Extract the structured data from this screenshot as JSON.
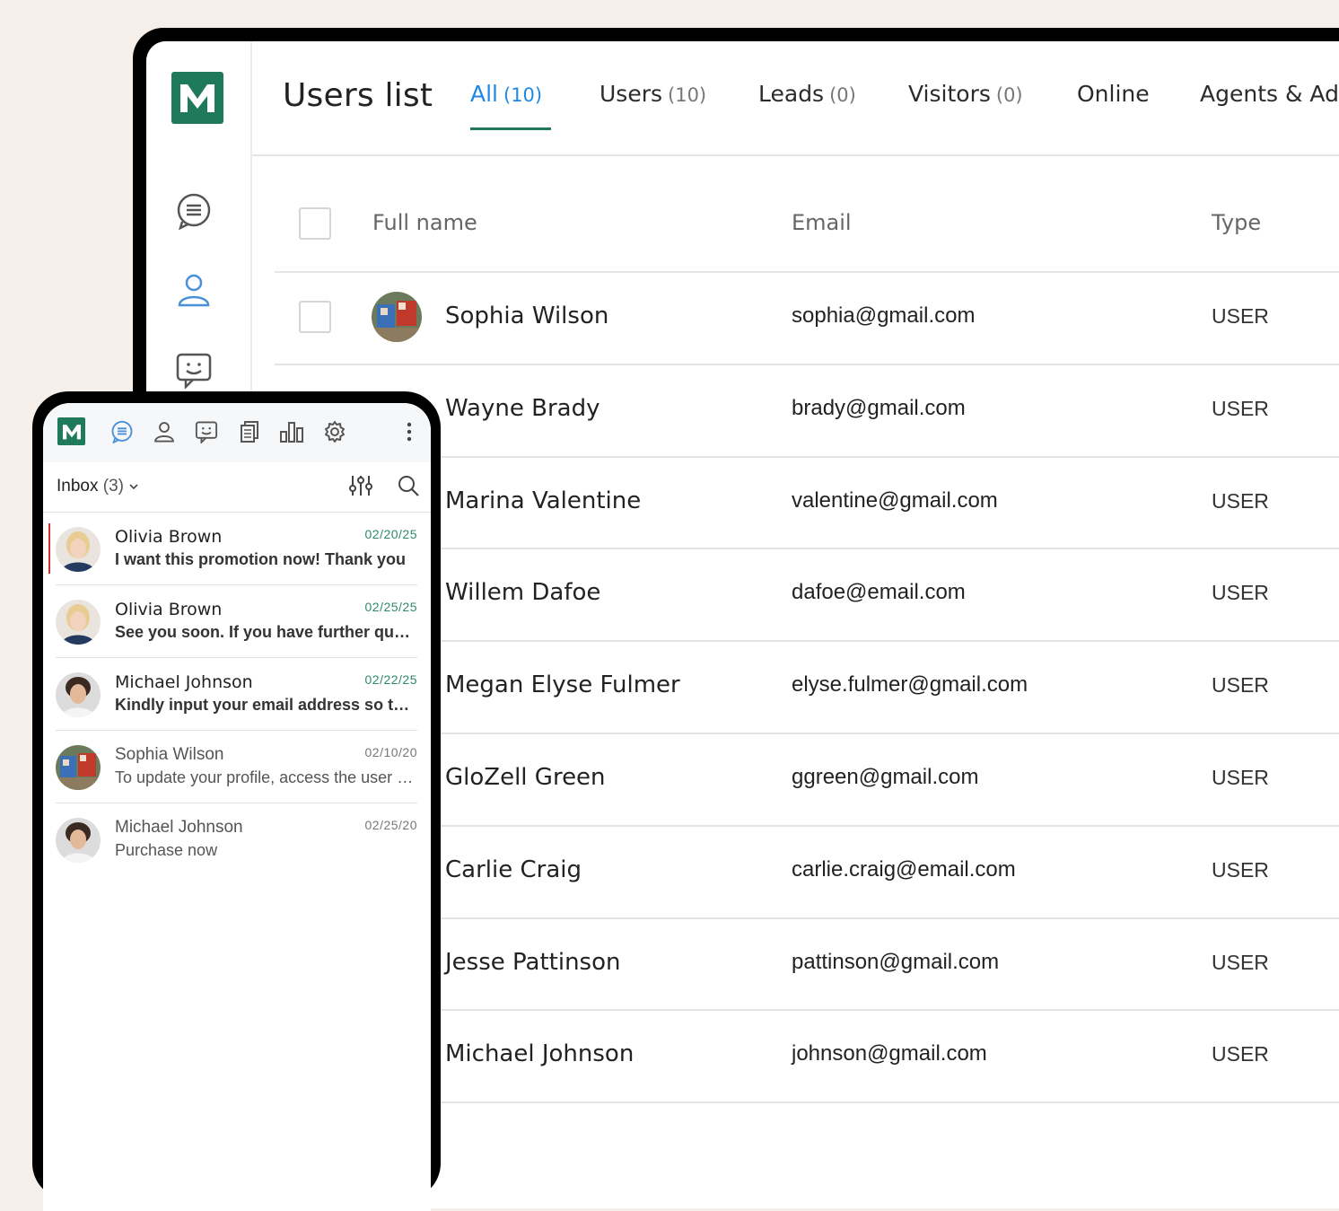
{
  "app": {
    "logo_letter": "M",
    "brand_color": "#1f7a5c",
    "accent_color": "#1e88e5"
  },
  "sidebar": {
    "icons": [
      "chat-icon",
      "user-icon",
      "feedback-icon"
    ]
  },
  "header": {
    "title": "Users list",
    "tabs": [
      {
        "label": "All",
        "count": "(10)",
        "active": true
      },
      {
        "label": "Users",
        "count": "(10)"
      },
      {
        "label": "Leads",
        "count": "(0)"
      },
      {
        "label": "Visitors",
        "count": "(0)"
      },
      {
        "label": "Online",
        "count": ""
      },
      {
        "label": "Agents & Ad",
        "count": ""
      }
    ]
  },
  "table": {
    "columns": [
      "Full name",
      "Email",
      "Type"
    ],
    "rows": [
      {
        "name": "Sophia Wilson",
        "email": "sophia@gmail.com",
        "type": "USER"
      },
      {
        "name": "Wayne Brady",
        "email": "brady@gmail.com",
        "type": "USER"
      },
      {
        "name": "Marina Valentine",
        "email": "valentine@gmail.com",
        "type": "USER"
      },
      {
        "name": "Willem Dafoe",
        "email": "dafoe@email.com",
        "type": "USER"
      },
      {
        "name": "Megan Elyse Fulmer",
        "email": "elyse.fulmer@gmail.com",
        "type": "USER"
      },
      {
        "name": "GloZell Green",
        "email": "ggreen@gmail.com",
        "type": "USER"
      },
      {
        "name": "Carlie Craig",
        "email": "carlie.craig@email.com",
        "type": "USER"
      },
      {
        "name": "Jesse Pattinson",
        "email": "pattinson@gmail.com",
        "type": "USER"
      },
      {
        "name": "Michael Johnson",
        "email": "johnson@gmail.com",
        "type": "USER"
      }
    ]
  },
  "phone": {
    "toolbar_icons": [
      "chat-icon",
      "user-icon",
      "feedback-icon",
      "articles-icon",
      "reports-icon",
      "settings-icon",
      "more-icon"
    ],
    "inbox_label": "Inbox",
    "inbox_count": "(3)",
    "conversations": [
      {
        "name": "Olivia Brown",
        "date": "02/20/25",
        "message": "I want this promotion now! Thank you",
        "unread": true,
        "selected": true
      },
      {
        "name": "Olivia Brown",
        "date": "02/25/25",
        "message": "See you soon. If you have further questions",
        "unread": true
      },
      {
        "name": "Michael Johnson",
        "date": "02/22/25",
        "message": "Kindly input your email address so that",
        "unread": true
      },
      {
        "name": "Sophia Wilson",
        "date": "02/10/20",
        "message": "To update your profile, access the user settings",
        "unread": false
      },
      {
        "name": "Michael Johnson",
        "date": "02/25/20",
        "message": "Purchase now",
        "unread": false
      }
    ]
  }
}
